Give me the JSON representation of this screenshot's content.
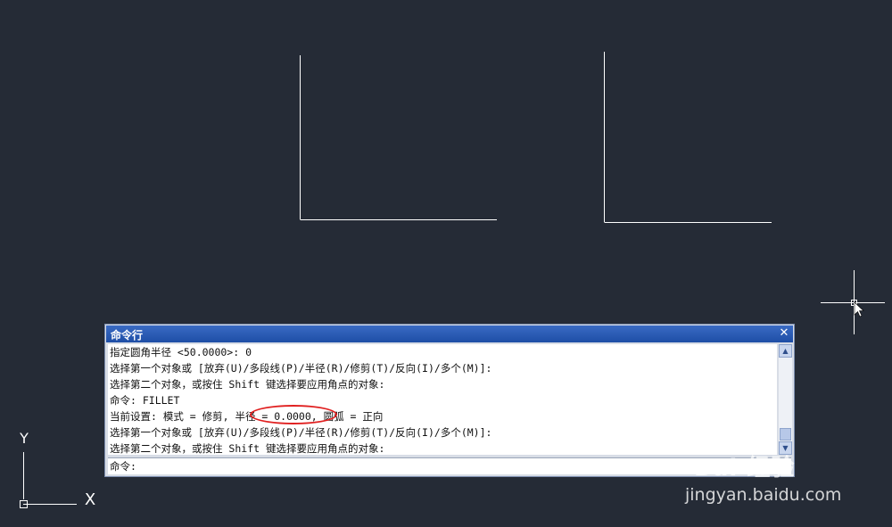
{
  "colors": {
    "canvas_background": "#252b36",
    "geometry_line": "#ffffff",
    "titlebar": "#2a5cb8",
    "highlight": "#e02020"
  },
  "ucs": {
    "y_label": "Y",
    "x_label": "X"
  },
  "command_window": {
    "title": "命令行",
    "close_glyph": "✕",
    "history": [
      "指定圆角半径 <50.0000>: 0",
      "选择第一个对象或 [放弃(U)/多段线(P)/半径(R)/修剪(T)/反向(I)/多个(M)]:",
      "选择第二个对象，或按住 Shift 键选择要应用角点的对象:",
      "命令: FILLET",
      "当前设置: 模式 = 修剪, 半径 = 0.0000, 圆弧 = 正向",
      "选择第一个对象或 [放弃(U)/多段线(P)/半径(R)/修剪(T)/反向(I)/多个(M)]:",
      "选择第二个对象，或按住 Shift 键选择要应用角点的对象:"
    ],
    "highlighted_text": "半径 = 0.0000",
    "prompt": "命令:",
    "input_value": ""
  },
  "icons": {
    "scroll_up": "scroll-up-arrow-icon",
    "scroll_down": "scroll-down-arrow-icon",
    "crosshair": "crosshair-cursor-icon",
    "ucs": "ucs-axis-icon"
  },
  "watermark": {
    "logo": "Bai 经验",
    "url": "jingyan.baidu.com"
  }
}
